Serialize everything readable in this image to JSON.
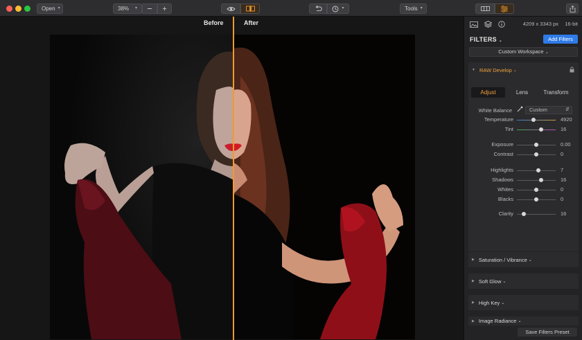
{
  "toolbar": {
    "open_label": "Open",
    "zoom_value": "38%",
    "tools_label": "Tools"
  },
  "canvas": {
    "before_label": "Before",
    "after_label": "After"
  },
  "panel": {
    "image_dimensions": "4209 x 3343 px",
    "bit_depth": "16-bit",
    "filters_title": "FILTERS",
    "add_filters_label": "Add Filters",
    "workspace_label": "Custom Workspace",
    "raw_develop": {
      "title": "RAW Develop",
      "tabs": [
        "Adjust",
        "Lens",
        "Transform"
      ],
      "selected_tab": "Adjust",
      "white_balance_label": "White Balance",
      "white_balance_value": "Custom",
      "sliders": [
        {
          "label": "Temperature",
          "value": "4920",
          "level": 0.42
        },
        {
          "label": "Tint",
          "value": "16",
          "level": 0.62
        },
        {
          "label": "Exposure",
          "value": "0.00",
          "level": 0.5
        },
        {
          "label": "Contrast",
          "value": "0",
          "level": 0.5
        },
        {
          "label": "Highlights",
          "value": "7",
          "level": 0.56
        },
        {
          "label": "Shadows",
          "value": "16",
          "level": 0.62
        },
        {
          "label": "Whites",
          "value": "0",
          "level": 0.5
        },
        {
          "label": "Blacks",
          "value": "0",
          "level": 0.5
        },
        {
          "label": "Clarity",
          "value": "16",
          "level": 0.18
        }
      ]
    },
    "collapsed_sections": [
      "Saturation / Vibrance",
      "Soft Glow",
      "High Key",
      "Image Radiance"
    ],
    "save_preset_label": "Save Filters Preset"
  },
  "colors": {
    "accent_orange": "#f29a2e",
    "button_blue": "#2f7be8",
    "panel_bg": "#232325",
    "toolbar_bg": "#2d2d30"
  }
}
